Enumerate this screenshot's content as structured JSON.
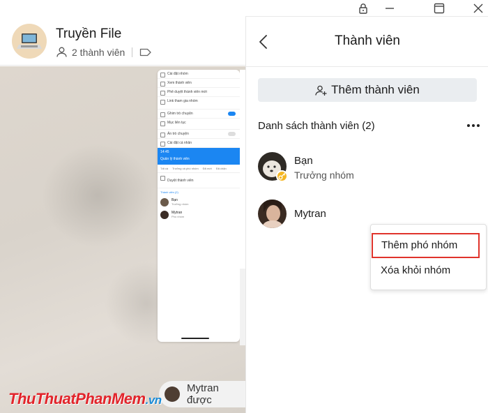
{
  "window": {
    "icons": [
      "lock-icon",
      "window-icon",
      "close-icon"
    ]
  },
  "chat": {
    "title": "Truyền File",
    "member_count": "2 thành viên",
    "toast_text": "Mytran được"
  },
  "panel": {
    "title": "Thành viên",
    "add_member_label": "Thêm thành viên",
    "list_heading": "Danh sách thành viên (2)",
    "members": [
      {
        "name": "Bạn",
        "role": "Trưởng nhóm"
      },
      {
        "name": "Mytran",
        "role": ""
      }
    ]
  },
  "context_menu": {
    "items": [
      {
        "label": "Thêm phó nhóm"
      },
      {
        "label": "Xóa khỏi nhóm"
      }
    ]
  },
  "embedded_screenshot": {
    "settings_rows": [
      "Cài đặt nhóm",
      "Xem thành viên",
      "Phê duyệt thành viên mới",
      "Link tham gia nhóm",
      "Ghim trò chuyện",
      "Mục liên tục",
      "Ẩn trò chuyện",
      "Cài đặt cá nhân"
    ],
    "top_bar_title": "Quản lý thành viên",
    "time": "14:45",
    "tabs": [
      "Tất cả",
      "Trưởng và phó nhóm",
      "Đã mời",
      "Đã chặn"
    ],
    "approve_row": "Duyệt thành viên",
    "section": "Thành viên (2)",
    "members": [
      {
        "name": "Bạn",
        "role": "Trưởng nhóm"
      },
      {
        "name": "Mytran",
        "role": "Phó nhóm"
      }
    ]
  },
  "watermark": {
    "text": "ThuThuatPhanMem",
    "suffix": ".vn"
  },
  "colors": {
    "accent_blue": "#1b86f2",
    "highlight_red": "#e0332b",
    "button_bg": "#eaedf0",
    "watermark_red": "#e2242b"
  }
}
